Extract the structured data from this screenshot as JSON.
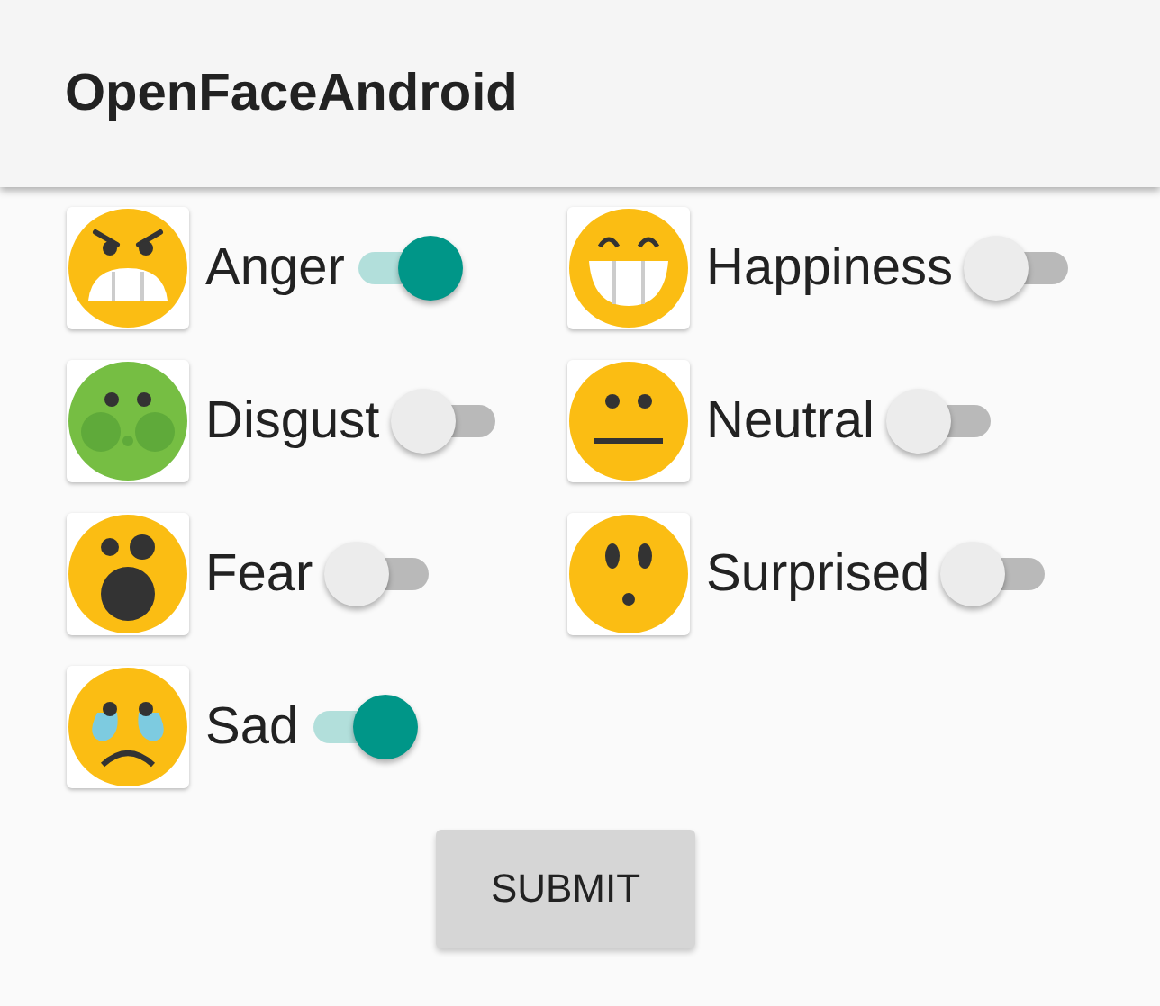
{
  "app_bar": {
    "title": "OpenFaceAndroid"
  },
  "emotions": [
    {
      "kind": "anger",
      "label": "Anger",
      "on": true
    },
    {
      "kind": "happiness",
      "label": "Happiness",
      "on": false
    },
    {
      "kind": "disgust",
      "label": "Disgust",
      "on": false
    },
    {
      "kind": "neutral",
      "label": "Neutral",
      "on": false
    },
    {
      "kind": "fear",
      "label": "Fear",
      "on": false
    },
    {
      "kind": "surprised",
      "label": "Surprised",
      "on": false
    },
    {
      "kind": "sad",
      "label": "Sad",
      "on": true
    }
  ],
  "submit_button": "SUBMIT"
}
